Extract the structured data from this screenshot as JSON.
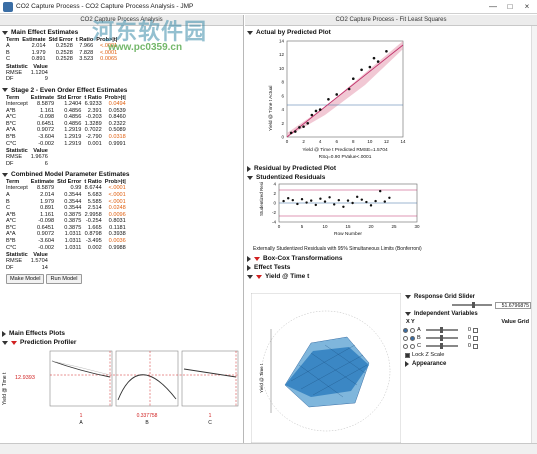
{
  "window": {
    "title": "CO2 Capture Process - CO2 Capture Process Analysis - JMP",
    "buttons": [
      "—",
      "□",
      "×"
    ]
  },
  "watermark": {
    "text": "河东软件园",
    "url": "www.pc0359.cn"
  },
  "left_pane": {
    "subtitle": "CO2 Capture Process Analysis",
    "main_effects": {
      "title": "Main Effect Estimates",
      "headers": [
        "Term",
        "Estimate",
        "Std Error",
        "t Ratio",
        "Prob>|t|"
      ],
      "rows": [
        [
          "A",
          "2.014",
          "0.2528",
          "7.966",
          "<.0001"
        ],
        [
          "B",
          "1.979",
          "0.2528",
          "7.828",
          "<.0001"
        ],
        [
          "C",
          "0.891",
          "0.2528",
          "3.523",
          "0.0065"
        ]
      ],
      "stat_headers": [
        "Statistic",
        "Value"
      ],
      "stats": [
        [
          "RMSE",
          "1.1204"
        ],
        [
          "DF",
          "9"
        ]
      ]
    },
    "stage2": {
      "title": "Stage 2 - Even Order Effect Estimates",
      "headers": [
        "Term",
        "Estimate",
        "Std Error",
        "t Ratio",
        "Prob>|t|"
      ],
      "rows": [
        [
          "Intercept",
          "8.5879",
          "1.2404",
          "6.9233",
          "0.0494"
        ],
        [
          "A*B",
          "1.161",
          "0.4856",
          "2.391",
          "0.0539"
        ],
        [
          "A*C",
          "-0.098",
          "0.4856",
          "-0.203",
          "0.8460"
        ],
        [
          "B*C",
          "0.6451",
          "0.4856",
          "1.3289",
          "0.2322"
        ],
        [
          "A*A",
          "0.9072",
          "1.2919",
          "0.7022",
          "0.5089"
        ],
        [
          "B*B",
          "-3.604",
          "1.2919",
          "-2.790",
          "0.0318"
        ],
        [
          "C*C",
          "-0.002",
          "1.2919",
          "0.001",
          "0.9991"
        ]
      ],
      "stat_headers": [
        "Statistic",
        "Value"
      ],
      "stats": [
        [
          "RMSE",
          "1.9676"
        ],
        [
          "DF",
          "6"
        ]
      ]
    },
    "combined": {
      "title": "Combined Model Parameter Estimates",
      "headers": [
        "Term",
        "Estimate",
        "Std Error",
        "t Ratio",
        "Prob>|t|"
      ],
      "rows": [
        [
          "Intercept",
          "8.5879",
          "0.99",
          "8.6744",
          "<.0001"
        ],
        [
          "A",
          "2.014",
          "0.3544",
          "5.683",
          "<.0001"
        ],
        [
          "B",
          "1.979",
          "0.3544",
          "5.585",
          "<.0001"
        ],
        [
          "C",
          "0.891",
          "0.3544",
          "2.514",
          "0.0248"
        ],
        [
          "A*B",
          "1.161",
          "0.3875",
          "2.9958",
          "0.0096"
        ],
        [
          "A*C",
          "-0.098",
          "0.3875",
          "-0.254",
          "0.8031"
        ],
        [
          "B*C",
          "0.6451",
          "0.3875",
          "1.665",
          "0.1181"
        ],
        [
          "A*A",
          "0.9072",
          "1.0311",
          "0.8798",
          "0.3938"
        ],
        [
          "B*B",
          "-3.604",
          "1.0311",
          "-3.495",
          "0.0036"
        ],
        [
          "C*C",
          "-0.002",
          "1.0311",
          "0.002",
          "0.9988"
        ]
      ],
      "stat_headers": [
        "Statistic",
        "Value"
      ],
      "stats": [
        [
          "RMSE",
          "1.5704"
        ],
        [
          "DF",
          "14"
        ]
      ]
    },
    "buttons": {
      "make_model": "Make Model",
      "run_model": "Run Model"
    },
    "main_effects_plots": "Main Effects Plots",
    "profiler": {
      "title": "Prediction Profiler",
      "ylabel": "Yield @ Time t",
      "current_y": "12.9393",
      "factors": [
        {
          "label": "A",
          "value": "1"
        },
        {
          "label": "B",
          "value": "0.337758"
        },
        {
          "label": "C",
          "value": "1"
        }
      ]
    }
  },
  "right_pane": {
    "subtitle": "CO2 Capture Process - Fit Least Squares",
    "actual_by_predicted": {
      "title": "Actual by Predicted Plot",
      "xlabel": "Yield @ Time t Predicted RMSE=1.5704",
      "ylabel": "Yield @ Time t Actual",
      "stats_line": "RSq=0.90 PValue<.0001"
    },
    "residual_by_predicted": "Residual by Predicted Plot",
    "studentized": {
      "title": "Studentized Residuals",
      "xlabel": "Row Number",
      "ylabel": "Studentized Residual",
      "footnote": "Externally Studentized Residuals with 95% Simultaneous Limits (Bonferroni)"
    },
    "box_cox": "Box-Cox Transformations",
    "effect_tests": "Effect Tests",
    "surface": {
      "title": "Yield @ Time t",
      "axis_label": "Yield @ Time t"
    },
    "slider_panel": {
      "response_title": "Response Grid Slider",
      "response_value": "51.6796875",
      "indep_title": "Independent Variables",
      "cols": [
        "X",
        "Y"
      ],
      "value_grid": "Value Grid",
      "vars": [
        {
          "name": "A",
          "value": "0"
        },
        {
          "name": "B",
          "value": "0"
        },
        {
          "name": "C",
          "value": "0"
        }
      ],
      "lock_z": "Lock Z Scale",
      "appearance": "Appearance"
    }
  },
  "chart_data": [
    {
      "type": "scatter",
      "title": "Actual by Predicted Plot",
      "xlabel": "Yield @ Time t Predicted RMSE=1.5704",
      "ylabel": "Yield @ Time t Actual",
      "xlim": [
        0,
        14
      ],
      "ylim": [
        0,
        14
      ],
      "x": [
        0.5,
        1.0,
        1.5,
        2.0,
        2.5,
        3.0,
        3.5,
        4.0,
        5.0,
        6.0,
        7.5,
        8.0,
        9.0,
        10.0,
        10.5,
        11.0,
        12.0
      ],
      "y": [
        0.6,
        0.8,
        1.4,
        1.5,
        2.0,
        3.2,
        3.8,
        4.0,
        5.5,
        6.2,
        7.0,
        8.5,
        9.8,
        10.2,
        11.5,
        11.0,
        12.5
      ]
    },
    {
      "type": "scatter",
      "title": "Studentized Residuals",
      "xlabel": "Row Number",
      "ylabel": "Studentized Residual",
      "xlim": [
        0,
        30
      ],
      "ylim": [
        -4,
        4
      ],
      "x": [
        1,
        2,
        3,
        4,
        5,
        6,
        7,
        8,
        9,
        10,
        11,
        12,
        13,
        14,
        15,
        16,
        17,
        18,
        19,
        20,
        21,
        22,
        23,
        24
      ],
      "y": [
        0.4,
        1.0,
        0.6,
        -0.2,
        0.8,
        0.1,
        0.5,
        -0.4,
        0.9,
        0.3,
        1.2,
        -0.3,
        0.6,
        -0.8,
        0.5,
        0.0,
        1.3,
        0.7,
        0.2,
        -0.5,
        0.4,
        2.5,
        0.3,
        1.1
      ]
    }
  ]
}
